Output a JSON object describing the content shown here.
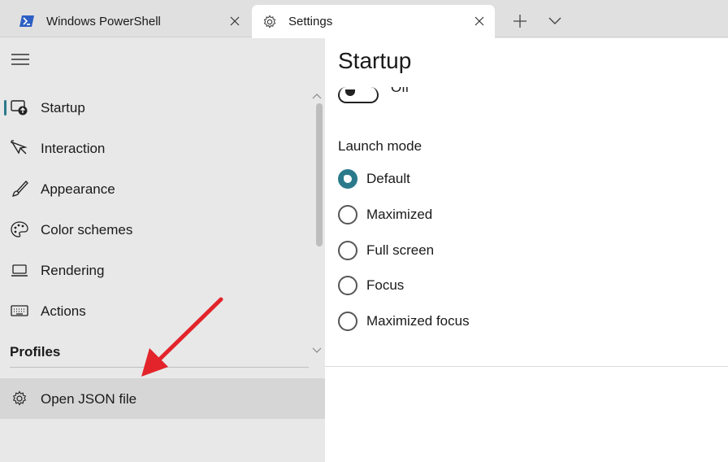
{
  "tabs": [
    {
      "title": "Windows PowerShell",
      "icon": "powershell-icon"
    },
    {
      "title": "Settings",
      "icon": "gear-icon"
    }
  ],
  "sidebar": {
    "items": [
      {
        "label": "Startup",
        "icon": "startup-icon"
      },
      {
        "label": "Interaction",
        "icon": "interaction-icon"
      },
      {
        "label": "Appearance",
        "icon": "brush-icon"
      },
      {
        "label": "Color schemes",
        "icon": "palette-icon"
      },
      {
        "label": "Rendering",
        "icon": "laptop-icon"
      },
      {
        "label": "Actions",
        "icon": "keyboard-icon"
      }
    ],
    "profiles_header": "Profiles",
    "open_json": {
      "label": "Open JSON file",
      "icon": "gear-icon"
    }
  },
  "main": {
    "title": "Startup",
    "toggle_label": "Off",
    "launch_mode": {
      "label": "Launch mode",
      "selected": "Default",
      "options": [
        "Default",
        "Maximized",
        "Full screen",
        "Focus",
        "Maximized focus"
      ]
    }
  },
  "colors": {
    "accent": "#2b7a8c",
    "annotation_arrow": "#e3242b"
  }
}
